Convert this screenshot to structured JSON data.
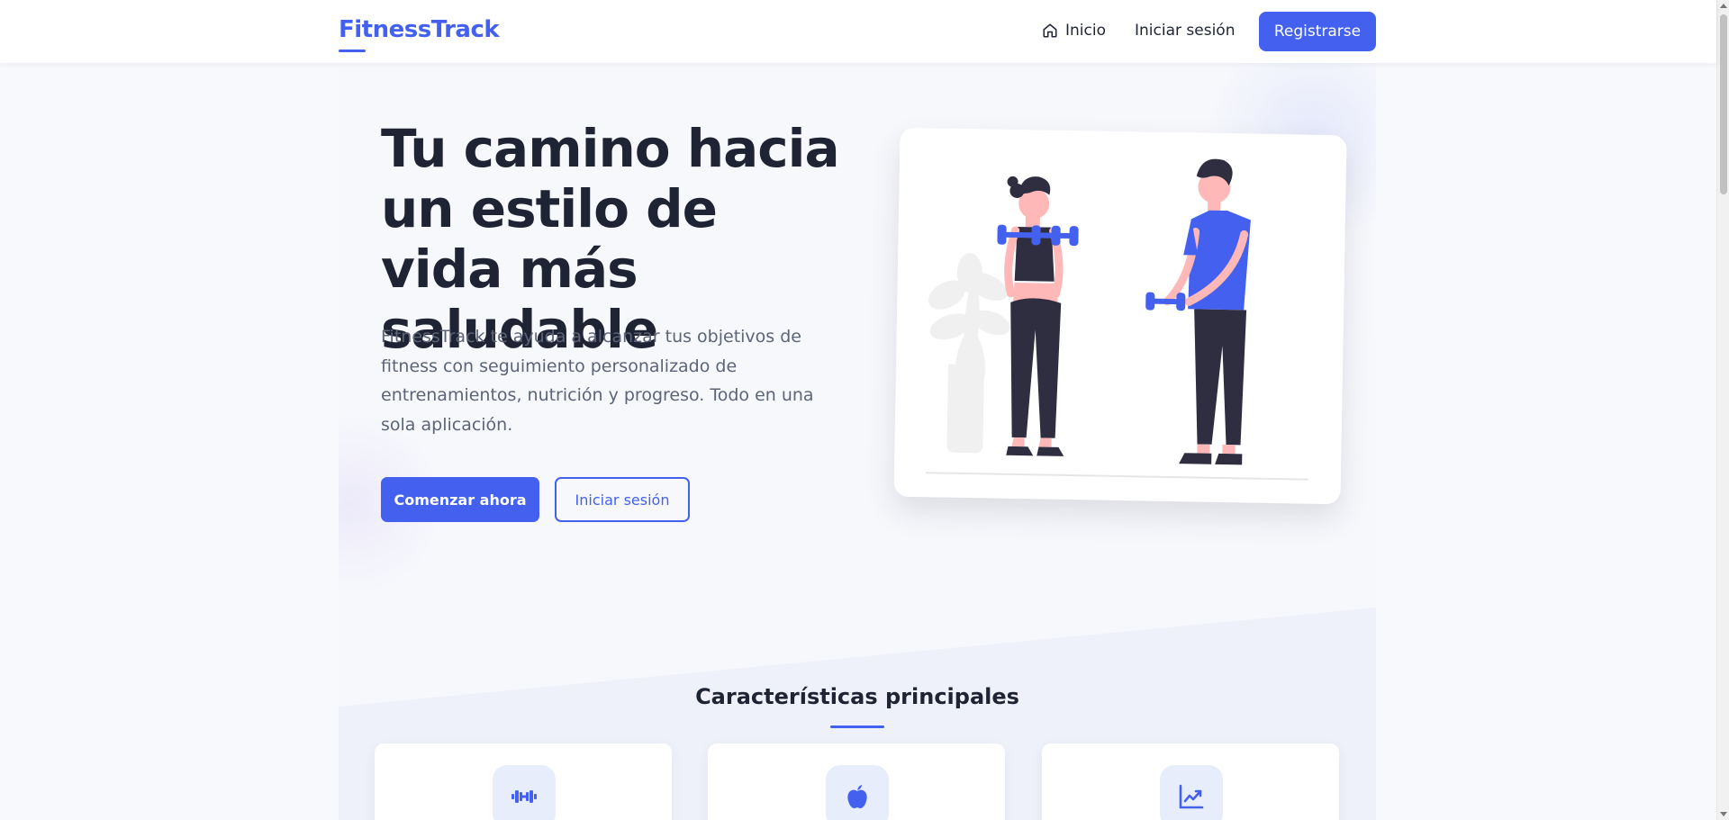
{
  "navbar": {
    "brand": "FitnessTrack",
    "links": {
      "home": "Inicio",
      "login": "Iniciar sesión"
    },
    "register_label": "Registrarse"
  },
  "hero": {
    "title": "Tu camino hacia un estilo de vida más saludable",
    "description": "FitnessTrack te ayuda a alcanzar tus objetivos de fitness con seguimiento personalizado de entrenamientos, nutrición y progreso. Todo en una sola aplicación.",
    "start_label": "Comenzar ahora",
    "login_label": "Iniciar sesión",
    "illustration": "people-exercising-with-dumbbells"
  },
  "features": {
    "title": "Características principales",
    "items": [
      {
        "icon": "dumbbell-icon"
      },
      {
        "icon": "apple-icon"
      },
      {
        "icon": "chart-line-icon"
      }
    ]
  },
  "colors": {
    "primary": "#4361ee",
    "text_dark": "#1e2433",
    "text_muted": "#5c6478",
    "background": "#f8f9fc"
  }
}
